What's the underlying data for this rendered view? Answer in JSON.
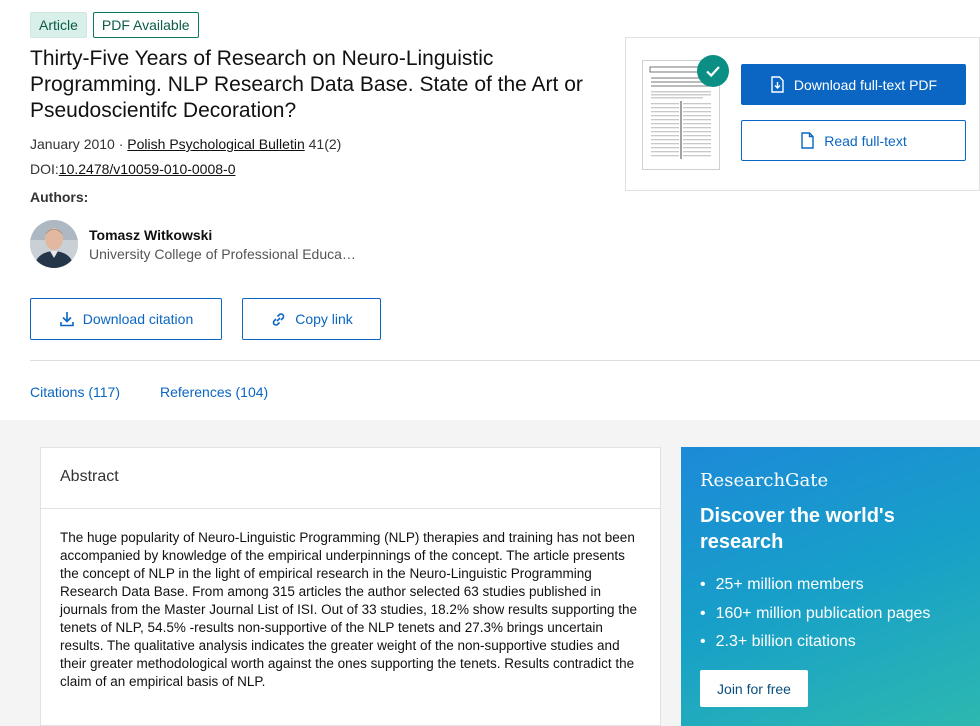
{
  "badges": {
    "article": "Article",
    "pdf_available": "PDF Available"
  },
  "paper": {
    "title": "Thirty-Five Years of Research on Neuro-Linguistic Programming. NLP Research Data Base. State of the Art or Pseudoscientifc Decoration?",
    "date": "January 2010",
    "separator": " · ",
    "journal": "Polish Psychological Bulletin",
    "issue": " 41(2)",
    "doi_label": "DOI:",
    "doi": "10.2478/v10059-010-0008-0"
  },
  "authors": {
    "label": "Authors:",
    "list": [
      {
        "name": "Tomasz Witkowski",
        "affiliation": "University College of Professional Educa…"
      }
    ]
  },
  "actions": {
    "download_citation": "Download citation",
    "copy_link": "Copy link",
    "download_pdf": "Download full-text PDF",
    "read_fulltext": "Read full-text"
  },
  "tabs": {
    "citations": "Citations (117)",
    "references": "References (104)"
  },
  "abstract": {
    "heading": "Abstract",
    "text": "The huge popularity of Neuro-Linguistic Programming (NLP) therapies and training has not been accompanied by knowledge of the empirical underpinnings of the concept. The article presents the concept of NLP in the light of empirical research in the Neuro-Linguistic Programming Research Data Base. From among 315 articles the author selected 63 studies published in journals from the Master Journal List of ISI. Out of 33 studies, 18.2% show results supporting the tenets of NLP, 54.5% -results non-supportive of the NLP tenets and 27.3% brings uncertain results. The qualitative analysis indicates the greater weight of the non-supportive studies and their greater methodological worth against the ones supporting the tenets. Results contradict the claim of an empirical basis of NLP."
  },
  "promo": {
    "logo": "ResearchGate",
    "heading": "Discover the world's research",
    "items": [
      "25+ million members",
      "160+ million publication pages",
      "2.3+ billion citations"
    ],
    "join": "Join for free"
  },
  "colors": {
    "primary": "#0a66c2",
    "accent_green": "#0b8f84",
    "badge_bg": "#d9efe9"
  }
}
